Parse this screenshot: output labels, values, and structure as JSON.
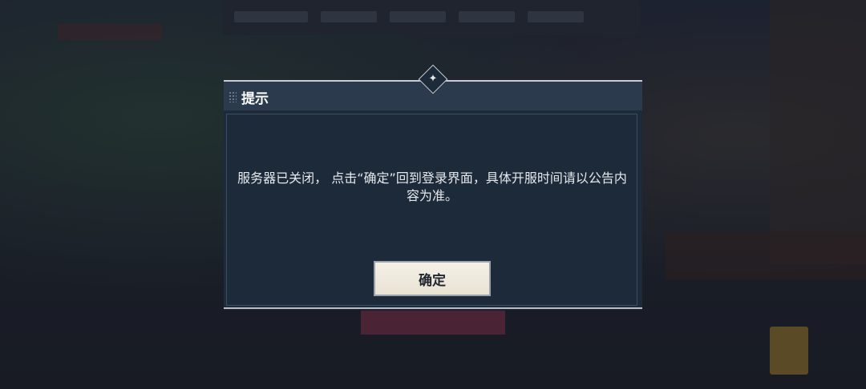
{
  "dialog": {
    "title": "提示",
    "message": "服务器已关闭， 点击“确定”回到登录界面，具体开服时间请以公告内容为准。",
    "confirm_label": "确定"
  }
}
